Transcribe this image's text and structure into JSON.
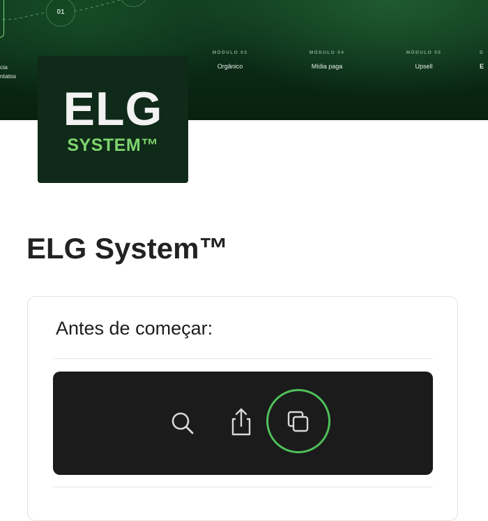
{
  "hero": {
    "module_num_01": "01",
    "left_caption_line1": "cia",
    "left_caption_line2": "ntatos",
    "modules": [
      {
        "label": "MÓDULO 03",
        "name": "Orgânico"
      },
      {
        "label": "MÓDULO 04",
        "name": "Mídia paga"
      },
      {
        "label": "MÓDULO 05",
        "name": "Upsell"
      },
      {
        "label": "D",
        "name": "E"
      }
    ]
  },
  "logo": {
    "main_text": "ELG",
    "sub_text": "SYSTEM™"
  },
  "page": {
    "title": "ELG System™"
  },
  "card": {
    "heading": "Antes de começar:",
    "toolbar_icons": [
      "search-icon",
      "share-icon",
      "copy-icon"
    ],
    "highlight_color": "#4fc15a"
  },
  "colors": {
    "hero_bg": "#0a2815",
    "logo_bg": "#0f2a18",
    "brand_green": "#7ed36e",
    "toolbar_bg": "#1b1b1b"
  }
}
